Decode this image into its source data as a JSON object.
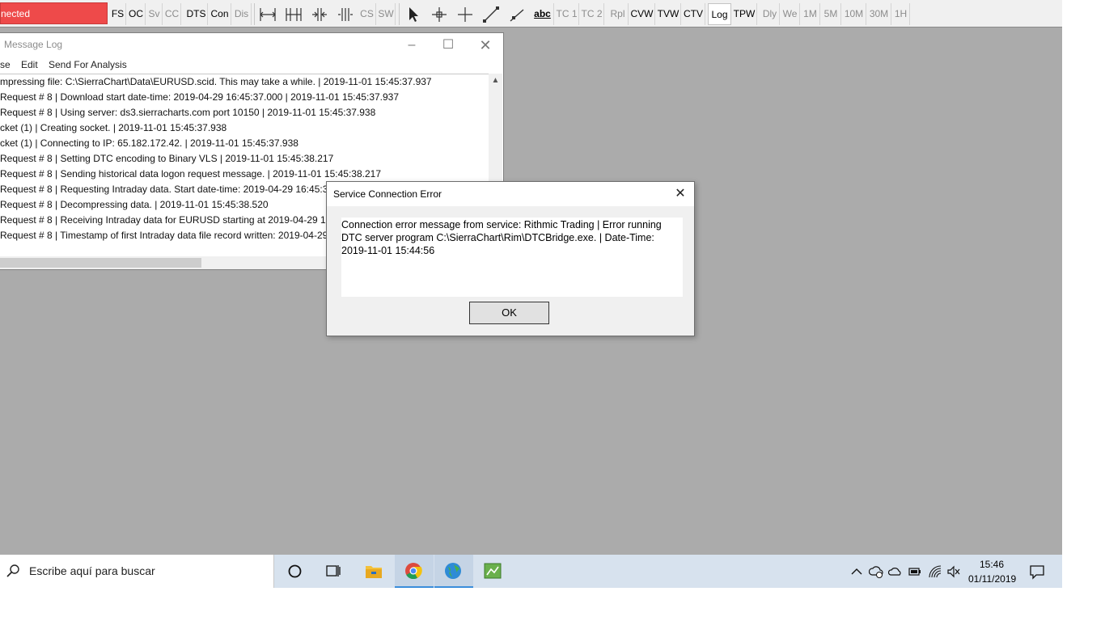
{
  "toolbar": {
    "connection_status": "nected",
    "buttons": [
      {
        "label": "FS"
      },
      {
        "label": "OC"
      },
      {
        "label": "Sv"
      },
      {
        "label": "CC"
      },
      {
        "label": "DTS"
      },
      {
        "label": "Con"
      },
      {
        "label": "Dis"
      },
      {
        "label": "CS"
      },
      {
        "label": "SW"
      },
      {
        "label": "TC 1"
      },
      {
        "label": "TC 2"
      },
      {
        "label": "Rpl"
      },
      {
        "label": "CVW"
      },
      {
        "label": "TVW"
      },
      {
        "label": "CTV"
      },
      {
        "label": "Log"
      },
      {
        "label": "TPW"
      },
      {
        "label": "Dly"
      },
      {
        "label": "We"
      },
      {
        "label": "1M"
      },
      {
        "label": "5M"
      },
      {
        "label": "10M"
      },
      {
        "label": "30M"
      },
      {
        "label": "1H"
      }
    ],
    "text_tool_label": "abc",
    "colors": {
      "status_bg": "#ee4a4a"
    }
  },
  "message_log": {
    "title": "Message Log",
    "menu": [
      "se",
      "Edit",
      "Send For Analysis"
    ],
    "lines": [
      "mpressing file: C:\\SierraChart\\Data\\EURUSD.scid.  This may take a while. | 2019-11-01  15:45:37.937",
      " Request # 8 | Download start date-time: 2019-04-29  16:45:37.000 | 2019-11-01  15:45:37.937",
      " Request # 8 | Using server: ds3.sierracharts.com port 10150 | 2019-11-01  15:45:37.938",
      "cket (1) | Creating socket. | 2019-11-01  15:45:37.938",
      "cket (1) | Connecting to IP: 65.182.172.42. | 2019-11-01  15:45:37.938",
      " Request # 8 | Setting DTC encoding to Binary VLS | 2019-11-01  15:45:38.217",
      " Request # 8 | Sending historical data logon request message. | 2019-11-01  15:45:38.217",
      " Request # 8 | Requesting Intraday data.  Start date-time: 2019-04-29  16:45:37",
      " Request # 8 | Decompressing data. | 2019-11-01  15:45:38.520",
      " Request # 8 | Receiving Intraday data for EURUSD starting at 2019-04-29  16:4",
      " Request # 8 | Timestamp of first Intraday data file record written: 2019-04-29"
    ]
  },
  "dialog": {
    "title": "Service Connection Error",
    "message_lines": [
      "Connection error message from service: Rithmic Trading | Error running",
      "DTC server program C:\\SierraChart\\Rim\\DTCBridge.exe. | Date-Time:",
      "2019-11-01  15:44:56"
    ],
    "ok_label": "OK"
  },
  "taskbar": {
    "search_placeholder": "Escribe aquí para buscar",
    "clock_time": "15:46",
    "clock_date": "01/11/2019",
    "apps": [
      "cortana-icon",
      "task-view-icon",
      "file-explorer-icon",
      "chrome-icon",
      "globe-app-icon",
      "green-app-icon"
    ]
  }
}
